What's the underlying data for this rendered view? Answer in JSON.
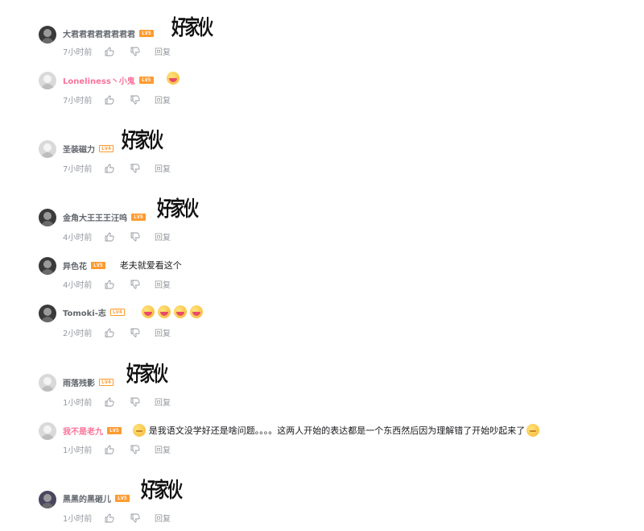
{
  "comments": [
    {
      "user": "大君君君君君君君君",
      "level": "LV5",
      "sticker": "好家伙",
      "time": "7小时前",
      "reply": "回复"
    },
    {
      "user": "Loneliness丶小鬼",
      "level": "LV5",
      "emoji": "drool-emoji",
      "time": "7小时前",
      "reply": "回复"
    },
    {
      "user": "圣装磁力",
      "level": "LV4",
      "sticker": "好家伙",
      "time": "7小时前",
      "reply": "回复"
    },
    {
      "user": "金角大王王王汪呜",
      "level": "LV5",
      "sticker": "好家伙",
      "time": "4小时前",
      "reply": "回复"
    },
    {
      "user": "异色花",
      "level": "LV5",
      "text": "老夫就爱看这个",
      "time": "4小时前",
      "reply": "回复"
    },
    {
      "user": "Tomoki-志",
      "level": "LV4",
      "emoji": "drool-emoji x4",
      "time": "2小时前",
      "reply": "回复"
    },
    {
      "user": "雨落残影",
      "level": "LV4",
      "sticker": "好家伙",
      "time": "1小时前",
      "reply": "回复"
    },
    {
      "user": "我不是老九",
      "level": "LV5",
      "text": "是我语文没学好还是啥问题。。。。这两人开始的表达都是一个东西然后因为理解错了开始吵起来了",
      "time": "1小时前",
      "reply": "回复"
    },
    {
      "user": "黑黑的黑砸儿",
      "level": "LV5",
      "sticker": "好家伙",
      "time": "1小时前",
      "reply": "回复"
    }
  ],
  "colors": {
    "username": "#61666d",
    "vip_username": "#fb7299",
    "level_badge": "#ff9a2e",
    "meta": "#9499a0",
    "text": "#18191c"
  },
  "icons": {
    "like": "thumbs-up-icon",
    "dislike": "thumbs-down-icon"
  }
}
